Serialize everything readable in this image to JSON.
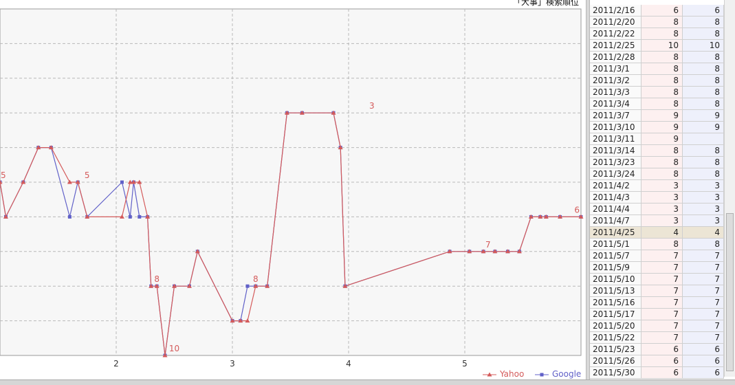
{
  "chart": {
    "title": "「大事」検索順位",
    "legend": [
      {
        "name": "Yahoo",
        "color": "#d45a5a",
        "marker": "triangle"
      },
      {
        "name": "Google",
        "color": "#6060c8",
        "marker": "square"
      }
    ]
  },
  "chart_data": {
    "type": "line",
    "title": "「大事」検索順位",
    "xlabel": "",
    "ylabel": "",
    "x_ticks": [
      "2",
      "3",
      "4",
      "5"
    ],
    "x_range": [
      1,
      6
    ],
    "y_range": [
      10,
      1
    ],
    "y_inverted": true,
    "grid": true,
    "legend_position": "bottom-right",
    "x": [
      1.0,
      1.05,
      1.2,
      1.33,
      1.44,
      1.6,
      1.67,
      1.75,
      2.05,
      2.12,
      2.15,
      2.2,
      2.27,
      2.3,
      2.35,
      2.42,
      2.5,
      2.63,
      2.7,
      3.0,
      3.07,
      3.13,
      3.2,
      3.3,
      3.47,
      3.6,
      3.87,
      3.93,
      3.97,
      4.87,
      5.04,
      5.16,
      5.26,
      5.37,
      5.47,
      5.57,
      5.65,
      5.7,
      5.82,
      6.0
    ],
    "series": [
      {
        "name": "Yahoo",
        "color": "#d45a5a",
        "values": [
          5,
          6,
          5,
          4,
          4,
          5,
          5,
          6,
          6,
          5,
          5,
          5,
          6,
          8,
          8,
          10,
          8,
          8,
          7,
          9,
          9,
          9,
          8,
          8,
          3,
          3,
          3,
          4,
          8,
          7,
          7,
          7,
          7,
          7,
          7,
          6,
          6,
          6,
          6,
          6
        ]
      },
      {
        "name": "Google",
        "color": "#6060c8",
        "values": [
          5,
          6,
          5,
          4,
          4,
          6,
          5,
          6,
          5,
          6,
          5,
          6,
          6,
          8,
          8,
          10,
          8,
          8,
          7,
          9,
          9,
          8,
          8,
          8,
          3,
          3,
          3,
          4,
          8,
          7,
          7,
          7,
          7,
          7,
          7,
          6,
          6,
          6,
          6,
          6
        ]
      }
    ],
    "annotations": [
      {
        "x": 1.0,
        "y": 5,
        "text": "5"
      },
      {
        "x": 1.75,
        "y": 5,
        "text": "5"
      },
      {
        "x": 2.35,
        "y": 8,
        "text": "8"
      },
      {
        "x": 2.5,
        "y": 10,
        "text": "10"
      },
      {
        "x": 3.2,
        "y": 8,
        "text": "8"
      },
      {
        "x": 4.2,
        "y": 3,
        "text": "3"
      },
      {
        "x": 5.2,
        "y": 7,
        "text": "7"
      },
      {
        "x": 6.0,
        "y": 6,
        "text": "6"
      }
    ]
  },
  "table": {
    "selected_index": 19,
    "rows": [
      {
        "date": "2011/2/16",
        "yahoo": "6",
        "google": "6"
      },
      {
        "date": "2011/2/20",
        "yahoo": "8",
        "google": "8"
      },
      {
        "date": "2011/2/22",
        "yahoo": "8",
        "google": "8"
      },
      {
        "date": "2011/2/25",
        "yahoo": "10",
        "google": "10"
      },
      {
        "date": "2011/2/28",
        "yahoo": "8",
        "google": "8"
      },
      {
        "date": "2011/3/1",
        "yahoo": "8",
        "google": "8"
      },
      {
        "date": "2011/3/2",
        "yahoo": "8",
        "google": "8"
      },
      {
        "date": "2011/3/3",
        "yahoo": "8",
        "google": "8"
      },
      {
        "date": "2011/3/4",
        "yahoo": "8",
        "google": "8"
      },
      {
        "date": "2011/3/7",
        "yahoo": "9",
        "google": "9"
      },
      {
        "date": "2011/3/10",
        "yahoo": "9",
        "google": "9"
      },
      {
        "date": "2011/3/11",
        "yahoo": "9",
        "google": ""
      },
      {
        "date": "2011/3/14",
        "yahoo": "8",
        "google": "8"
      },
      {
        "date": "2011/3/23",
        "yahoo": "8",
        "google": "8"
      },
      {
        "date": "2011/3/24",
        "yahoo": "8",
        "google": "8"
      },
      {
        "date": "2011/4/2",
        "yahoo": "3",
        "google": "3"
      },
      {
        "date": "2011/4/3",
        "yahoo": "3",
        "google": "3"
      },
      {
        "date": "2011/4/4",
        "yahoo": "3",
        "google": "3"
      },
      {
        "date": "2011/4/7",
        "yahoo": "3",
        "google": "3"
      },
      {
        "date": "2011/4/25",
        "yahoo": "4",
        "google": "4"
      },
      {
        "date": "2011/5/1",
        "yahoo": "8",
        "google": "8"
      },
      {
        "date": "2011/5/7",
        "yahoo": "7",
        "google": "7"
      },
      {
        "date": "2011/5/9",
        "yahoo": "7",
        "google": "7"
      },
      {
        "date": "2011/5/10",
        "yahoo": "7",
        "google": "7"
      },
      {
        "date": "2011/5/13",
        "yahoo": "7",
        "google": "7"
      },
      {
        "date": "2011/5/16",
        "yahoo": "7",
        "google": "7"
      },
      {
        "date": "2011/5/17",
        "yahoo": "7",
        "google": "7"
      },
      {
        "date": "2011/5/20",
        "yahoo": "7",
        "google": "7"
      },
      {
        "date": "2011/5/22",
        "yahoo": "7",
        "google": "7"
      },
      {
        "date": "2011/5/23",
        "yahoo": "6",
        "google": "6"
      },
      {
        "date": "2011/5/26",
        "yahoo": "6",
        "google": "6"
      },
      {
        "date": "2011/5/30",
        "yahoo": "6",
        "google": "6"
      }
    ]
  }
}
